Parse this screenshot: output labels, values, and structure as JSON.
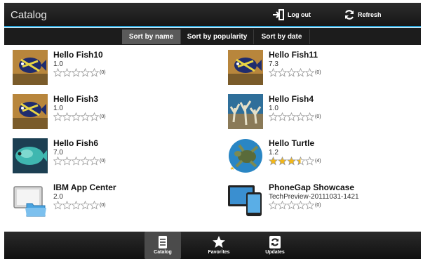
{
  "header": {
    "title": "Catalog",
    "logout_label": "Log out",
    "refresh_label": "Refresh"
  },
  "sort_tabs": [
    {
      "label": "Sort by name",
      "active": true
    },
    {
      "label": "Sort by popularity",
      "active": false
    },
    {
      "label": "Sort by date",
      "active": false
    }
  ],
  "apps": [
    {
      "name": "Hello Fish10",
      "version": "1.0",
      "rating": 0,
      "count": "(0)",
      "icon": "fish-icon"
    },
    {
      "name": "Hello Fish11",
      "version": "7.3",
      "rating": 0,
      "count": "(0)",
      "icon": "fish-icon"
    },
    {
      "name": "Hello Fish3",
      "version": "1.0",
      "rating": 0,
      "count": "(0)",
      "icon": "fish-icon"
    },
    {
      "name": "Hello Fish4",
      "version": "1.0",
      "rating": 0,
      "count": "(0)",
      "icon": "coral-icon"
    },
    {
      "name": "Hello Fish6",
      "version": "7.0",
      "rating": 0,
      "count": "(0)",
      "icon": "parrotfish-icon"
    },
    {
      "name": "Hello Turtle",
      "version": "1.2",
      "rating": 3.5,
      "count": "(4)",
      "icon": "turtle-icon"
    },
    {
      "name": "IBM App Center",
      "version": "2.0",
      "rating": 0,
      "count": "(0)",
      "icon": "monitor-folder-icon"
    },
    {
      "name": "PhoneGap Showcase",
      "version": "TechPreview-20111031-1421",
      "rating": 0,
      "count": "(0)",
      "icon": "tablet-phone-icon"
    }
  ],
  "bottom_nav": [
    {
      "label": "Catalog",
      "active": true,
      "icon": "catalog-icon"
    },
    {
      "label": "Favorites",
      "active": false,
      "icon": "star-icon"
    },
    {
      "label": "Updates",
      "active": false,
      "icon": "updates-icon"
    }
  ],
  "colors": {
    "accent": "#2aa4d8",
    "star_filled": "#f2b718",
    "bar_dark": "#1c1c1c"
  }
}
